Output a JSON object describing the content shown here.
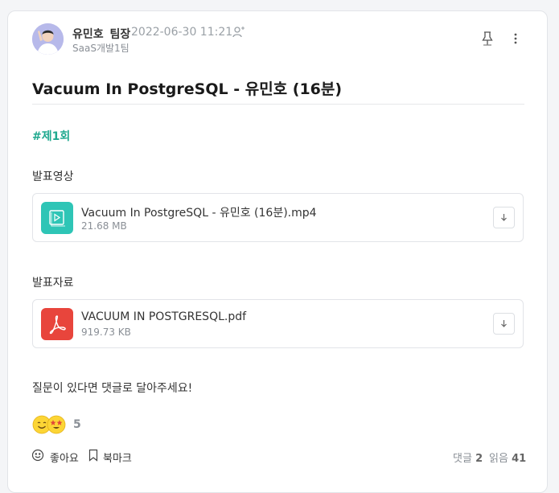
{
  "post": {
    "author_name": "유민호",
    "author_role": "팀장",
    "datetime": "2022-06-30 11:21",
    "team": "SaaS개발1팀",
    "title": "Vacuum In PostgreSQL - 유민호 (16분)",
    "hashtag": "#제1회",
    "question": "질문이 있다면 댓글로 달아주세요!"
  },
  "sections": {
    "video_label": "발표영상",
    "doc_label": "발표자료"
  },
  "files": [
    {
      "name": "Vacuum In PostgreSQL - 유민호 (16분).mp4",
      "size": "21.68 MB",
      "icon": "video-file-icon",
      "color": "#2ec5b6"
    },
    {
      "name": "VACUUM IN POSTGRESQL.pdf",
      "size": "919.73 KB",
      "icon": "pdf-file-icon",
      "color": "#e8453c"
    }
  ],
  "reactions": {
    "count": "5",
    "icons": [
      "smile-emoji-icon",
      "star-eyes-emoji-icon"
    ]
  },
  "actions": {
    "like_label": "좋아요",
    "bookmark_label": "북마크"
  },
  "stats": {
    "comments_label": "댓글",
    "comments_count": "2",
    "reads_label": "읽음",
    "reads_count": "41"
  },
  "colors": {
    "accent": "#20a98f",
    "video": "#2ec5b6",
    "pdf": "#e8453c"
  }
}
